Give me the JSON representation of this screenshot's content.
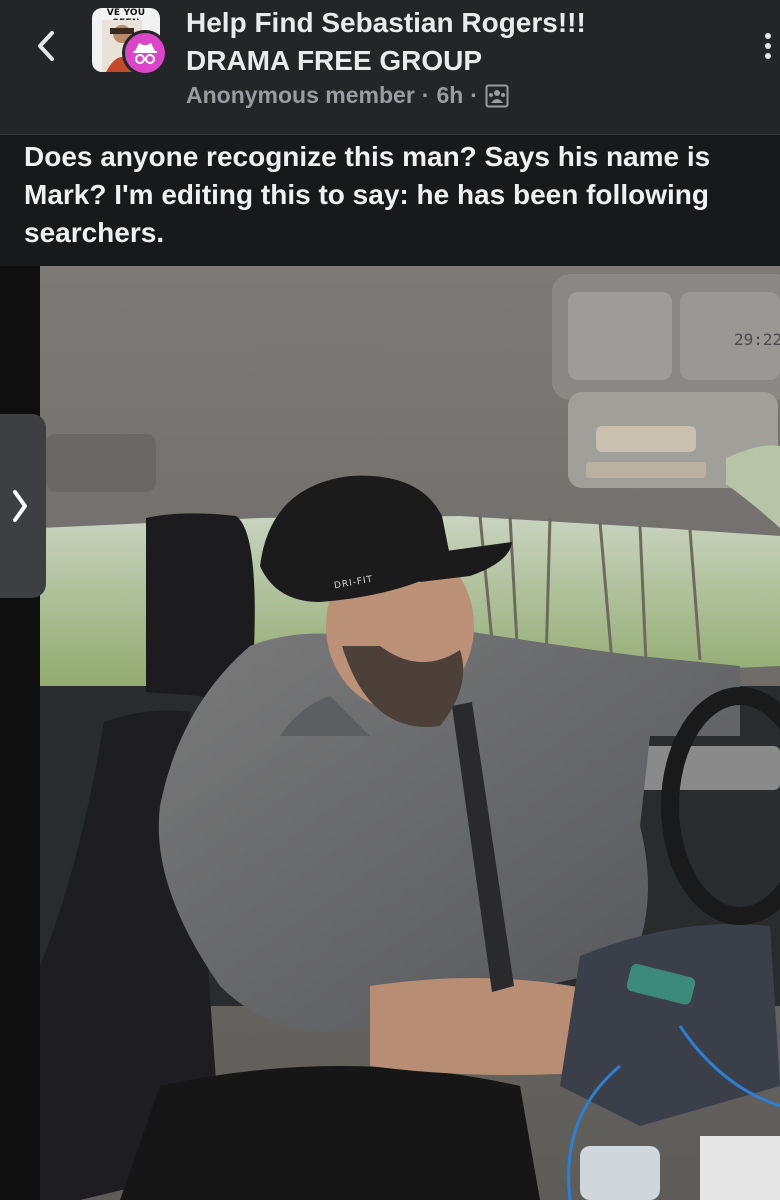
{
  "header": {
    "back_icon": "chevron-left-icon",
    "group_thumbnail_caption": "VE YOU SEEN",
    "anonymous_badge_icon": "incognito-icon",
    "title_line1": "Help Find Sebastian Rogers!!!",
    "title_line2": "DRAMA FREE GROUP",
    "author": "Anonymous member",
    "separator": "·",
    "time": "6h",
    "audience_icon": "group-members-icon",
    "more_icon": "more-options-icon"
  },
  "post": {
    "text": "Does anyone recognize this man? Says his name is Mark? I'm editing this to say: he has been following searchers."
  },
  "photo": {
    "timestamp_overlay": "29:22",
    "cap_logo": "DRI-FIT"
  },
  "pager": {
    "next_icon": "chevron-right-icon"
  },
  "colors": {
    "background": "#18191a",
    "header": "#242526",
    "anon_badge": "#d946c8",
    "muted_text": "#9a9ca1"
  }
}
